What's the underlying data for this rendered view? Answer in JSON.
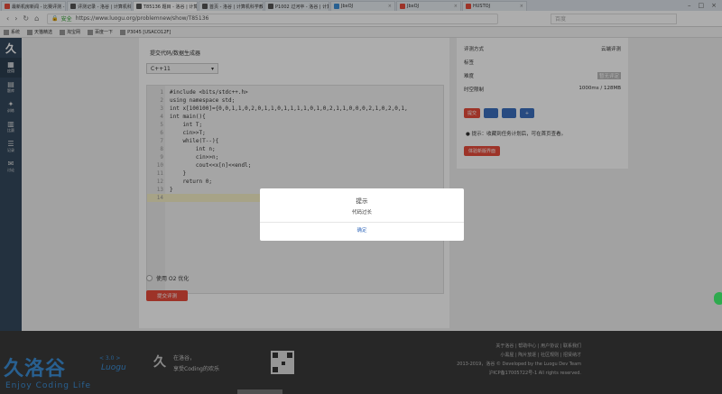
{
  "browser": {
    "tabs": [
      {
        "label": "最新机房新闻 - 比赛评测 - 洛谷",
        "fav": "red"
      },
      {
        "label": "评测记录 - 洛谷 | 计算机科学教",
        "fav": "dark"
      },
      {
        "label": "T85136 题目 - 洛谷 | 计算机科学",
        "fav": "dark",
        "active": true
      },
      {
        "label": "首页 - 洛谷 | 计算机科学教育新",
        "fav": "dark"
      },
      {
        "label": "P1002 过河卒 - 洛谷 | 计算机科学",
        "fav": "dark"
      },
      {
        "label": "JbxOJ",
        "fav": "blue"
      },
      {
        "label": "JbxOJ",
        "fav": "red"
      },
      {
        "label": "HUSTOJ",
        "fav": "red"
      }
    ],
    "url_prefix": "安全",
    "url": "https://www.luogu.org/problemnew/show/T85136",
    "search_placeholder": "百度",
    "bookmarks": [
      "系统",
      "天猫精选",
      "淘宝网",
      "百度一下",
      "P3045 [USACO12F]"
    ]
  },
  "sidebar": {
    "logo": "久",
    "items": [
      {
        "label": "应用",
        "icon": "grid-icon"
      },
      {
        "label": "题库",
        "icon": "book-icon"
      },
      {
        "label": "训练",
        "icon": "bulb-icon"
      },
      {
        "label": "比赛",
        "icon": "chart-icon"
      },
      {
        "label": "记录",
        "icon": "list-icon"
      },
      {
        "label": "讨论",
        "icon": "chat-icon"
      }
    ]
  },
  "editor_panel": {
    "title": "提交代码/数据生成器",
    "language": "C++11",
    "lines": [
      "#include <bits/stdc++.h>",
      "using namespace std;",
      "int x[100100]={0,0,1,1,0,2,0,1,1,0,1,1,1,1,0,1,0,2,1,1,0,0,0,2,1,0,2,0,1,",
      "int main(){",
      "    int T;",
      "    cin>>T;",
      "    while(T--){",
      "        int n;",
      "        cin>>n;",
      "        cout<<x[n]<<endl;",
      "    }",
      "    return 0;",
      "}",
      ""
    ],
    "o2_label": "使用 O2 优化",
    "submit_label": "提交评测"
  },
  "info_panel": {
    "rows": [
      {
        "key": "评测方式",
        "value": "云端评测"
      },
      {
        "key": "标签",
        "value": ""
      },
      {
        "key": "难度",
        "value": "暂无评定"
      },
      {
        "key": "时空限制",
        "value": "1000ms / 128MB"
      }
    ],
    "buttons": [
      "提交",
      "",
      "",
      "+"
    ],
    "tip": "提示：收藏到任务计划后，可在首页查看。",
    "examine_label": "体验新版界面"
  },
  "footer": {
    "logo_text": "洛谷",
    "version": "< 3.0 >",
    "sub": "Luogu",
    "slogan": "Enjoy Coding Life",
    "mark": "久",
    "slogan_line1": "在洛谷，",
    "slogan_line2": "享受Coding的欢乐",
    "links": [
      "关于洛谷 | 帮助中心 | 用户协议 | 联系我们",
      "小黑屋 | 陶片放逐 | 社区规则 | 招贤纳才",
      "2013-2019，洛谷 © Developed by the Luogu Dev Team",
      "沪ICP备17005722号-1 All rights reserved."
    ]
  },
  "modal": {
    "title": "提示",
    "message": "代码过长",
    "ok_label": "确定"
  }
}
